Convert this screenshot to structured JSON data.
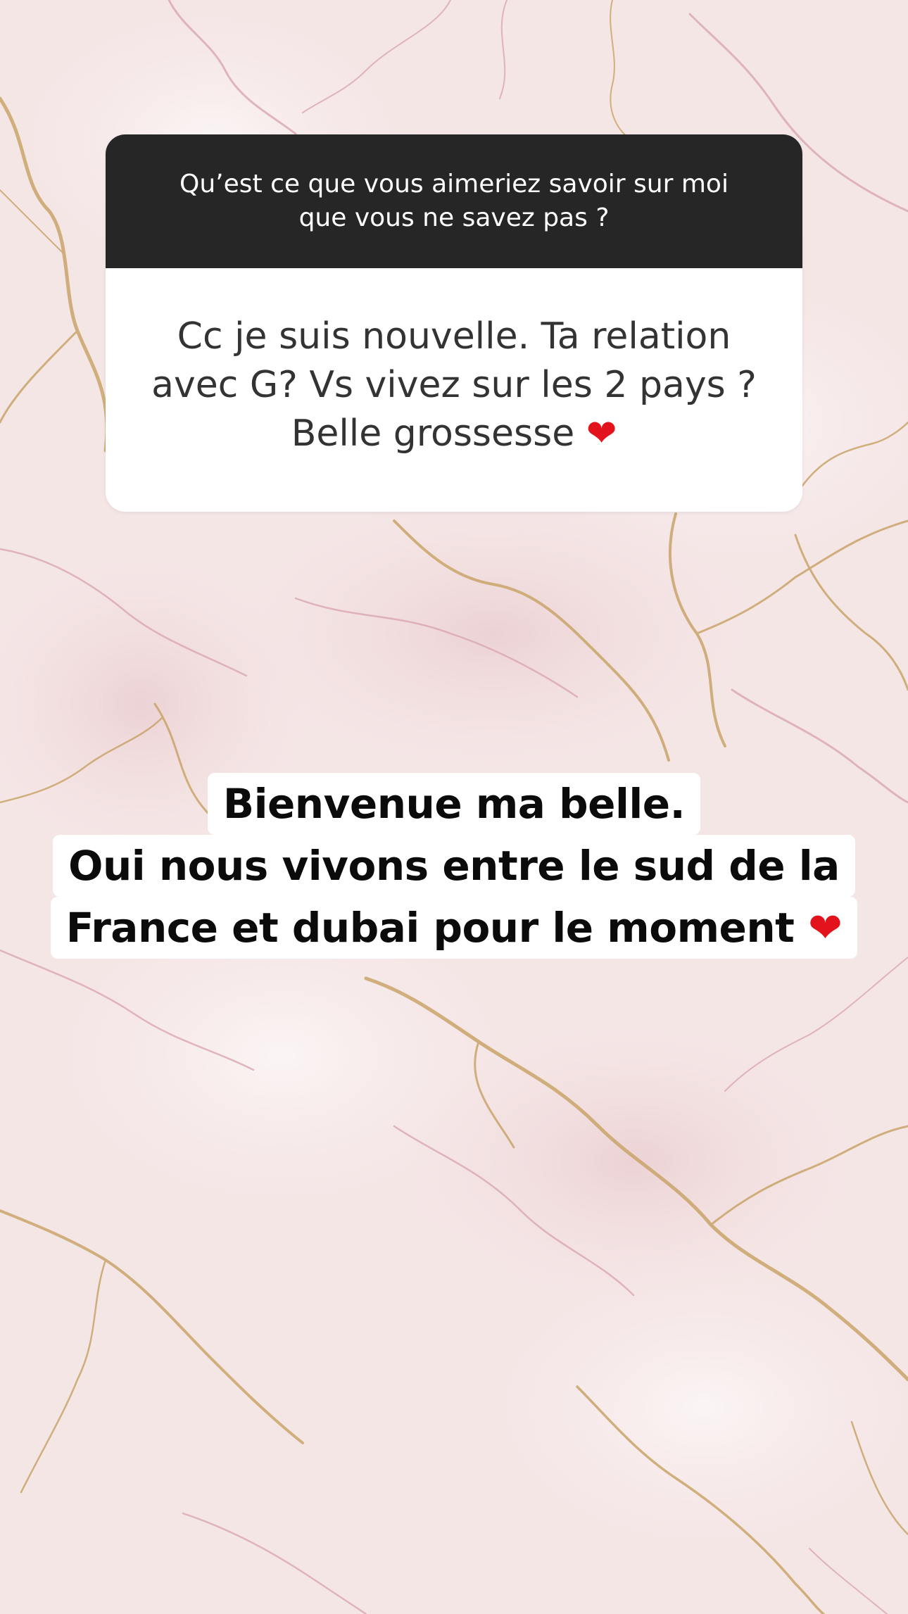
{
  "question_box": {
    "prompt": "Qu’est ce que vous aimeriez savoir sur moi\nque vous ne savez pas ?",
    "response": "Cc je suis nouvelle. Ta relation\navec G? Vs vivez sur les 2 pays ?\nBelle grossesse",
    "response_emoji": "❤"
  },
  "answer_text": {
    "line1": "Bienvenue ma belle.",
    "line2": "Oui nous vivons entre le sud de la",
    "line3": "France et dubai pour le moment",
    "line3_emoji": "❤"
  },
  "colors": {
    "header_bg": "#262626",
    "card_bg": "#ffffff",
    "heart": "#e3131d",
    "marble_base": "#f6e8e8",
    "vein_gold": "#c9a46a",
    "vein_pink": "#d9a9b0"
  },
  "icons": [
    "red-heart-emoji"
  ]
}
